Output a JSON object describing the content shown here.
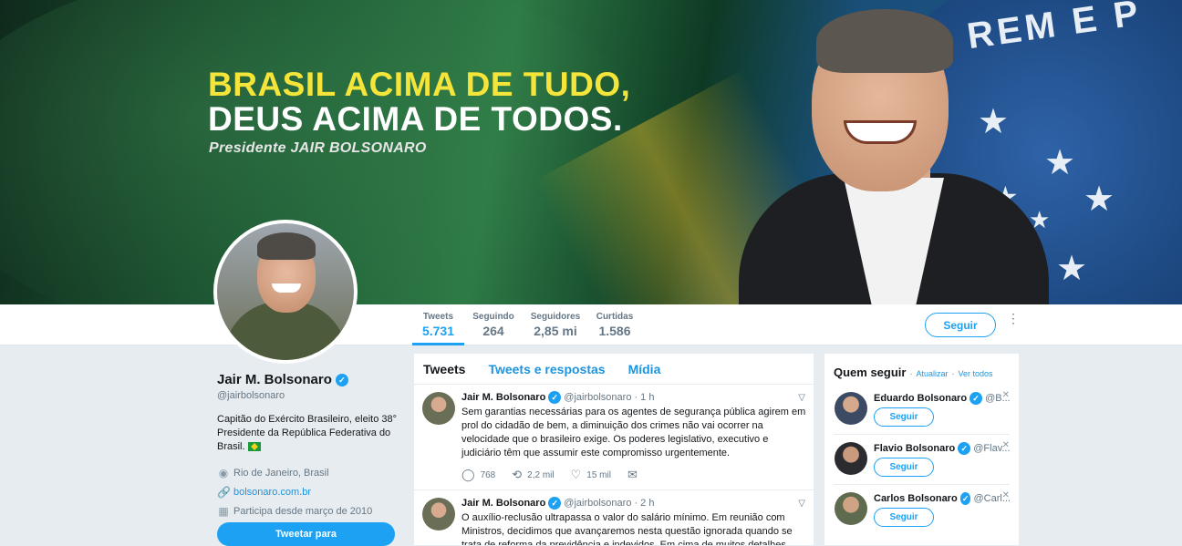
{
  "banner": {
    "line1": "BRASIL ACIMA DE TUDO,",
    "line2": "DEUS ACIMA DE TODOS.",
    "line3": "Presidente JAIR BOLSONARO",
    "flag_word": "REM E P"
  },
  "stats": [
    {
      "label": "Tweets",
      "value": "5.731"
    },
    {
      "label": "Seguindo",
      "value": "264"
    },
    {
      "label": "Seguidores",
      "value": "2,85 mi"
    },
    {
      "label": "Curtidas",
      "value": "1.586"
    }
  ],
  "follow_button": "Seguir",
  "more_icon": "⋮",
  "profile": {
    "name": "Jair M. Bolsonaro",
    "handle": "@jairbolsonaro",
    "bio": "Capitão do Exército Brasileiro, eleito 38° Presidente da República Federativa do Brasil.",
    "location": "Rio de Janeiro, Brasil",
    "website": "bolsonaro.com.br",
    "joined": "Participa desde março de 2010",
    "tweet_to": "Tweetar para"
  },
  "tabs": [
    "Tweets",
    "Tweets e respostas",
    "Mídia"
  ],
  "tweets": [
    {
      "name": "Jair M. Bolsonaro",
      "handle": "@jairbolsonaro",
      "time": "· 1 h",
      "text": "Sem garantias necessárias para os agentes de segurança pública agirem em prol do cidadão de bem, a diminuição dos crimes não vai ocorrer na velocidade que o brasileiro exige. Os poderes legislativo, executivo e judiciário têm que assumir este compromisso urgentemente.",
      "replies": "768",
      "retweets": "2,2 mil",
      "likes": "15 mil"
    },
    {
      "name": "Jair M. Bolsonaro",
      "handle": "@jairbolsonaro",
      "time": "· 2 h",
      "text": "O auxílio-reclusão ultrapassa o valor do salário mínimo. Em reunião com Ministros, decidimos que avançaremos nesta questão ignorada quando se trata de reforma da previdência e indevidos. Em cima de muitos detalhes vamos"
    }
  ],
  "who_to_follow": {
    "title": "Quem seguir",
    "refresh": "Atualizar",
    "view_all": "Ver todos",
    "separator": "·",
    "follow_label": "Seguir",
    "users": [
      {
        "name": "Eduardo Bolsonaro",
        "handle": "@B..."
      },
      {
        "name": "Flavio Bolsonaro",
        "handle": "@Flav..."
      },
      {
        "name": "Carlos Bolsonaro",
        "handle": "@Carl..."
      }
    ]
  },
  "colors": {
    "accent": "#1da1f2",
    "link": "#1b95e0",
    "muted": "#657786",
    "background": "#e6ecf0"
  }
}
